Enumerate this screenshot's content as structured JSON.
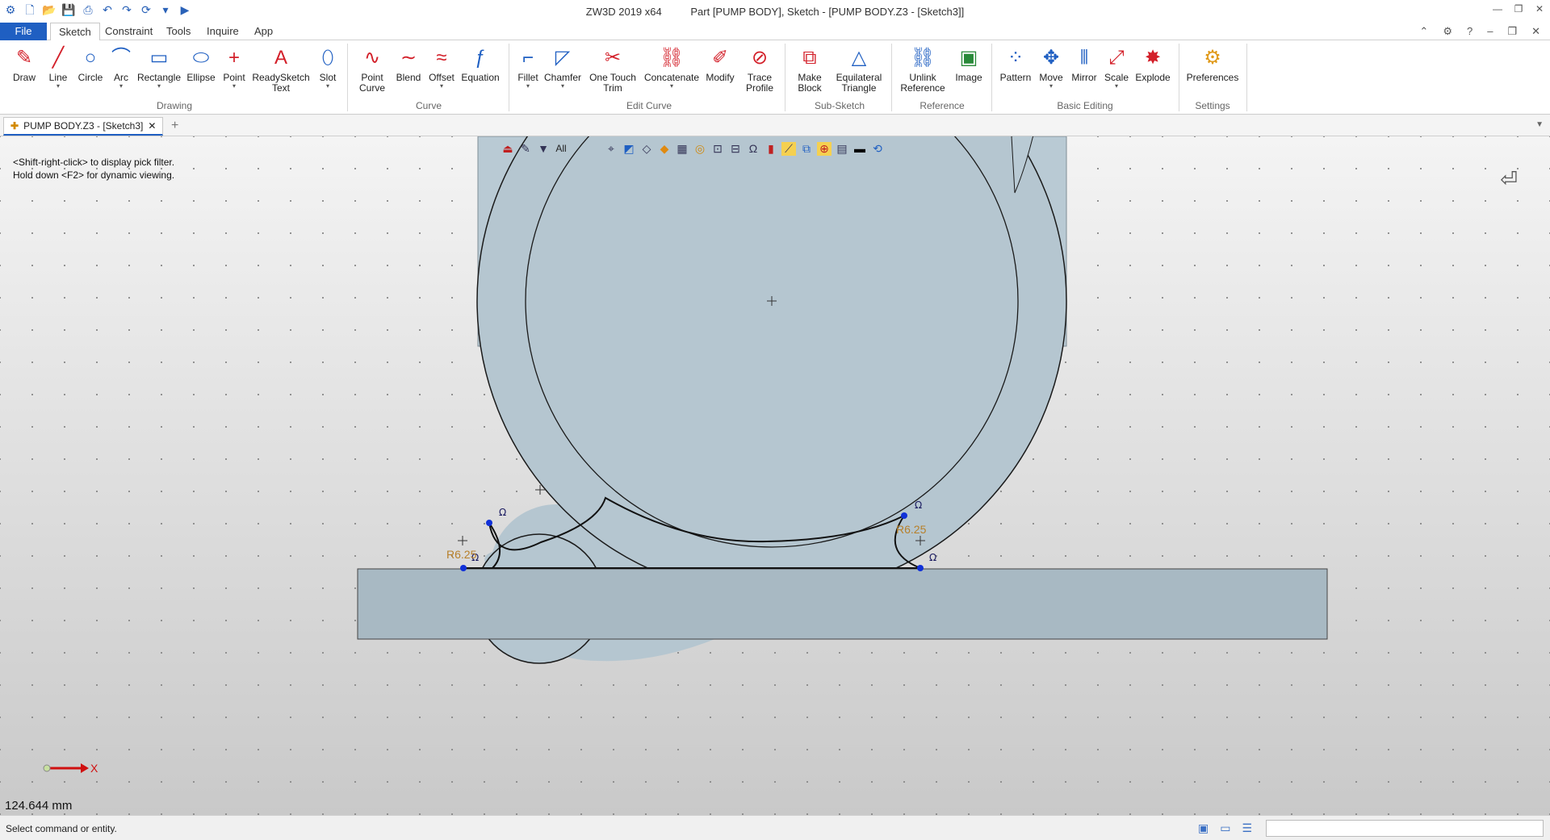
{
  "title_bar": {
    "app": "ZW3D 2019  x64",
    "document": "Part [PUMP BODY],  Sketch - [PUMP BODY.Z3 - [Sketch3]]"
  },
  "menu": {
    "tabs": [
      "File",
      "Sketch",
      "Constraint",
      "Tools",
      "Inquire",
      "App"
    ],
    "active": "Sketch"
  },
  "ribbon": {
    "groups": {
      "drawing": "Drawing",
      "curve": "Curve",
      "edit_curve": "Edit Curve",
      "sub_sketch": "Sub-Sketch",
      "reference": "Reference",
      "basic_editing": "Basic Editing",
      "settings": "Settings"
    },
    "buttons": {
      "draw": "Draw",
      "line": "Line",
      "circle": "Circle",
      "arc": "Arc",
      "rectangle": "Rectangle",
      "ellipse": "Ellipse",
      "point": "Point",
      "readysketch_text": "ReadySketch\nText",
      "slot": "Slot",
      "point_curve": "Point\nCurve",
      "blend": "Blend",
      "offset": "Offset",
      "equation": "Equation",
      "fillet": "Fillet",
      "chamfer": "Chamfer",
      "one_touch_trim": "One Touch\nTrim",
      "concatenate": "Concatenate",
      "modify": "Modify",
      "trace_profile": "Trace\nProfile",
      "make_block": "Make\nBlock",
      "equilateral_triangle": "Equilateral\nTriangle",
      "unlink_reference": "Unlink\nReference",
      "image": "Image",
      "pattern": "Pattern",
      "move": "Move",
      "mirror": "Mirror",
      "scale": "Scale",
      "explode": "Explode",
      "preferences": "Preferences"
    }
  },
  "document_tab": {
    "label": "PUMP BODY.Z3 - [Sketch3]"
  },
  "viewport": {
    "hints": [
      "<Shift-right-click> to display pick filter.",
      "Hold down <F2> for dynamic viewing."
    ],
    "filter": "All",
    "dimensions": [
      "R6.25",
      "R6.25"
    ],
    "axis_label": "X",
    "measure": "124.644 mm"
  },
  "status": {
    "text": "Select command or entity."
  },
  "colors": {
    "file_tab": "#1f5fc2",
    "part_fill": "#b5c6d0",
    "dimension": "#b7802a",
    "point_marker": "#1030d8"
  }
}
